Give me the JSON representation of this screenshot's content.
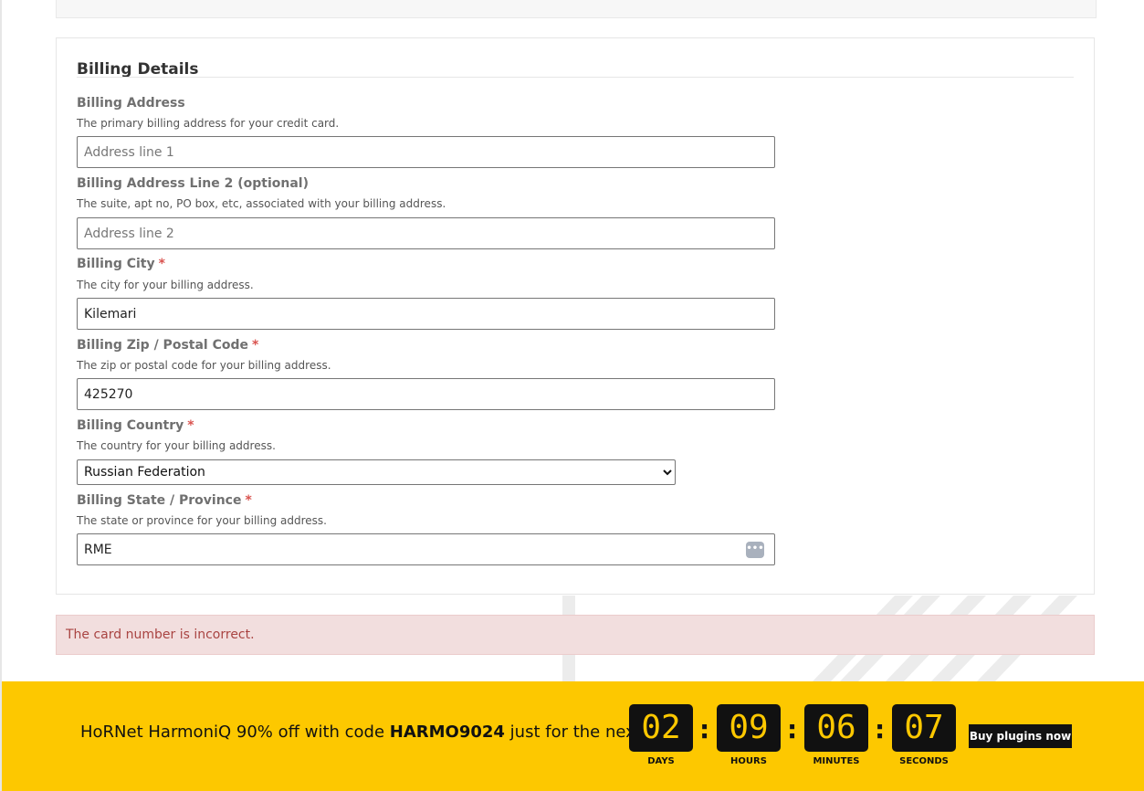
{
  "billing": {
    "title": "Billing Details",
    "fields": [
      {
        "label": "Billing Address",
        "required": false,
        "hint": "The primary billing address for your credit card.",
        "value": "",
        "placeholder": "Address line 1"
      },
      {
        "label": "Billing Address Line 2 (optional)",
        "required": false,
        "hint": "The suite, apt no, PO box, etc, associated with your billing address.",
        "value": "",
        "placeholder": "Address line 2"
      },
      {
        "label": "Billing City",
        "required": true,
        "hint": "The city for your billing address.",
        "value": "Kilemari",
        "placeholder": ""
      },
      {
        "label": "Billing Zip / Postal Code",
        "required": true,
        "hint": "The zip or postal code for your billing address.",
        "value": "425270",
        "placeholder": ""
      },
      {
        "label": "Billing Country",
        "required": true,
        "hint": "The country for your billing address.",
        "value": "Russian Federation",
        "placeholder": ""
      },
      {
        "label": "Billing State / Province",
        "required": true,
        "hint": "The state or province for your billing address.",
        "value": "RME",
        "placeholder": ""
      }
    ],
    "required_marker": "*",
    "autofill_icon": "password-manager-icon"
  },
  "alert": {
    "message": "The card number is incorrect.",
    "background": "#f2dede",
    "color": "#a94442"
  },
  "promo": {
    "text_before": "HoRNet HarmoniQ 90% off with code ",
    "code": "HARMO9024",
    "text_after": " just for the next",
    "countdown": [
      {
        "value": "02",
        "label": "DAYS"
      },
      {
        "value": "09",
        "label": "HOURS"
      },
      {
        "value": "06",
        "label": "MINUTES"
      },
      {
        "value": "07",
        "label": "SECONDS"
      }
    ],
    "separator": ":",
    "button_label": "Buy plugins now",
    "background": "#fdc800"
  }
}
